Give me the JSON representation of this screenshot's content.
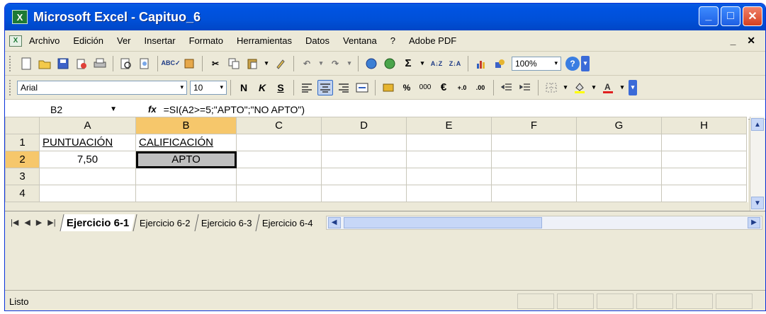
{
  "window": {
    "title": "Microsoft Excel - Capituo_6",
    "icon": "excel-icon",
    "controls": [
      "minimize-icon",
      "maximize-icon",
      "close-icon"
    ]
  },
  "menu": {
    "items": [
      "Archivo",
      "Edición",
      "Ver",
      "Insertar",
      "Formato",
      "Herramientas",
      "Datos",
      "Ventana",
      "?",
      "Adobe PDF"
    ],
    "right": "_ ✕"
  },
  "toolbar_standard": {
    "zoom": "100%"
  },
  "toolbar_format": {
    "font_name": "Arial",
    "font_size": "10",
    "bold": "N",
    "italic": "K",
    "underline": "S",
    "percent": "%",
    "thousands": "000",
    "euro": "€"
  },
  "formula_bar": {
    "name_box": "B2",
    "fx": "fx",
    "formula": "=SI(A2>=5;\"APTO\";\"NO APTO\")"
  },
  "sheet": {
    "columns": [
      "A",
      "B",
      "C",
      "D",
      "E",
      "F",
      "G",
      "H"
    ],
    "rows": [
      "1",
      "2",
      "3",
      "4"
    ],
    "cells": {
      "A1": "PUNTUACIÓN",
      "B1": "CALIFICACIÓN",
      "A2": "7,50",
      "B2": "APTO"
    },
    "active_cell": "B2"
  },
  "tabs": {
    "items": [
      "Ejercicio 6-1",
      "Ejercicio 6-2",
      "Ejercicio 6-3",
      "Ejercicio 6-4"
    ],
    "active": "Ejercicio 6-1"
  },
  "status": {
    "text": "Listo"
  },
  "colors": {
    "titlebar": "#0053E1",
    "selected_header": "#F6C76B",
    "active_cell_fill": "#BFBFBF"
  }
}
